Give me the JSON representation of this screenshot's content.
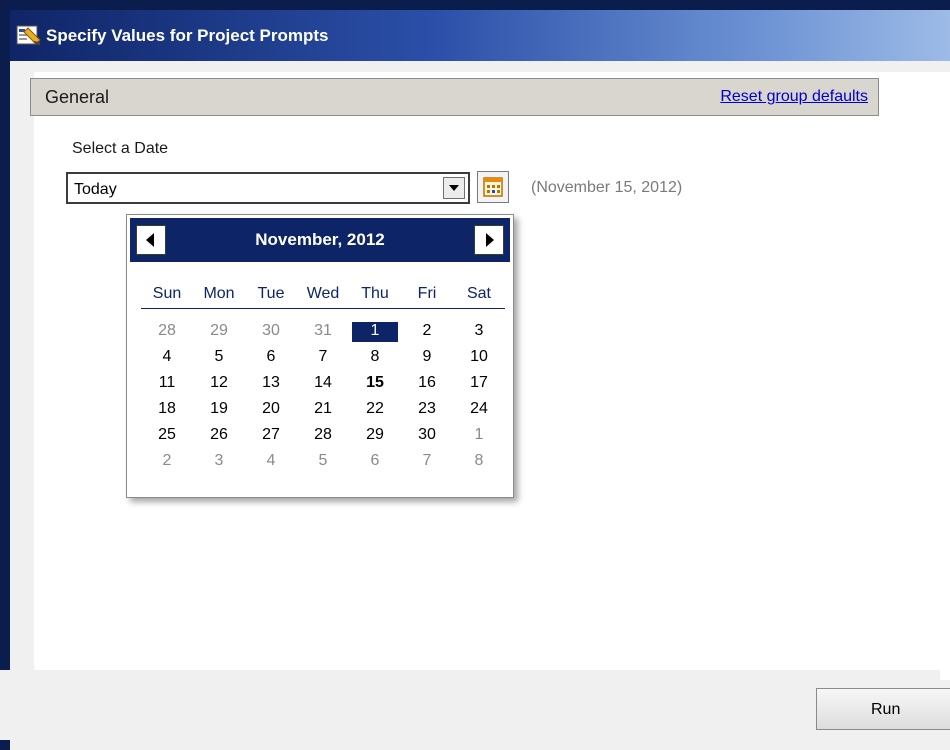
{
  "window": {
    "title": "Specify Values for Project Prompts"
  },
  "group": {
    "title": "General",
    "reset_label": "Reset group defaults"
  },
  "prompt": {
    "label": "Select a Date",
    "selected_value": "Today",
    "resolved_date": "(November 15, 2012)"
  },
  "calendar": {
    "month_label": "November, 2012",
    "day_names": [
      "Sun",
      "Mon",
      "Tue",
      "Wed",
      "Thu",
      "Fri",
      "Sat"
    ],
    "weeks": [
      [
        "28",
        "29",
        "30",
        "31",
        "1",
        "2",
        "3"
      ],
      [
        "4",
        "5",
        "6",
        "7",
        "8",
        "9",
        "10"
      ],
      [
        "11",
        "12",
        "13",
        "14",
        "15",
        "16",
        "17"
      ],
      [
        "18",
        "19",
        "20",
        "21",
        "22",
        "23",
        "24"
      ],
      [
        "25",
        "26",
        "27",
        "28",
        "29",
        "30",
        "1"
      ],
      [
        "2",
        "3",
        "4",
        "5",
        "6",
        "7",
        "8"
      ]
    ],
    "selected_day": "1",
    "today_day": "15",
    "header_color": "#0d2466",
    "icons": {
      "prev": "chevron-left-icon",
      "next": "chevron-right-icon"
    }
  },
  "footer": {
    "run_label": "Run"
  }
}
